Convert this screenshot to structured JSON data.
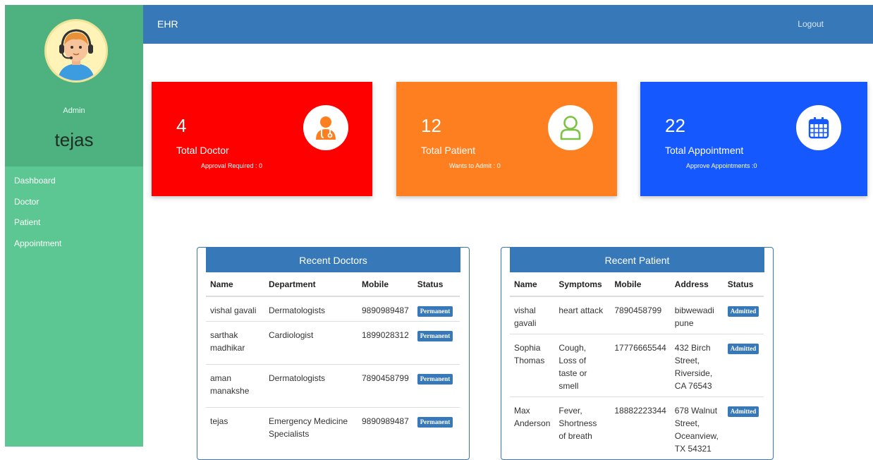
{
  "app": {
    "brand": "EHR",
    "logout": "Logout"
  },
  "sidebar": {
    "role": "Admin",
    "username": "tejas",
    "items": [
      {
        "label": "Dashboard"
      },
      {
        "label": "Doctor"
      },
      {
        "label": "Patient"
      },
      {
        "label": "Appointment"
      }
    ]
  },
  "cards": [
    {
      "value": "4",
      "label": "Total Doctor",
      "sub": "Approval Required : 0",
      "color": "#ff0000",
      "icon": "doctor-icon"
    },
    {
      "value": "12",
      "label": "Total Patient",
      "sub": "Wants to Admit : 0",
      "color": "#fd7f1f",
      "icon": "user-outline-icon"
    },
    {
      "value": "22",
      "label": "Total Appointment",
      "sub": "Approve Appointments :0",
      "color": "#1558fd",
      "icon": "calendar-icon"
    }
  ],
  "recent_doctors": {
    "title": "Recent Doctors",
    "columns": [
      "Name",
      "Department",
      "Mobile",
      "Status"
    ],
    "rows": [
      {
        "name": "vishal gavali",
        "department": "Dermatologists",
        "mobile": "9890989487",
        "status": "Permanent"
      },
      {
        "name": "sarthak madhikar",
        "department": "Cardiologist",
        "mobile": "1899028312",
        "status": "Permanent"
      },
      {
        "name": "aman manakshe",
        "department": "Dermatologists",
        "mobile": "7890458799",
        "status": "Permanent"
      },
      {
        "name": "tejas",
        "department": "Emergency Medicine Specialists",
        "mobile": "9890989487",
        "status": "Permanent"
      }
    ]
  },
  "recent_patients": {
    "title": "Recent Patient",
    "columns": [
      "Name",
      "Symptoms",
      "Mobile",
      "Address",
      "Status"
    ],
    "rows": [
      {
        "name": "vishal gavali",
        "symptoms": "heart attack",
        "mobile": "7890458799",
        "address": "bibwewadi pune",
        "status": "Admitted"
      },
      {
        "name": "Sophia Thomas",
        "symptoms": "Cough, Loss of taste or smell",
        "mobile": "17776665544",
        "address": "432 Birch Street, Riverside, CA 76543",
        "status": "Admitted"
      },
      {
        "name": "Max Anderson",
        "symptoms": "Fever, Shortness of breath",
        "mobile": "18882223344",
        "address": "678 Walnut Street, Oceanview, TX 54321",
        "status": "Admitted"
      }
    ]
  },
  "colors": {
    "header": "#3779b8",
    "sidebar": "#5cc792",
    "sidebar_profile": "#4db27f",
    "patient_icon": "#7cc242",
    "doctor_icon": "#fd7f1f",
    "calendar_icon": "#1558fd"
  }
}
